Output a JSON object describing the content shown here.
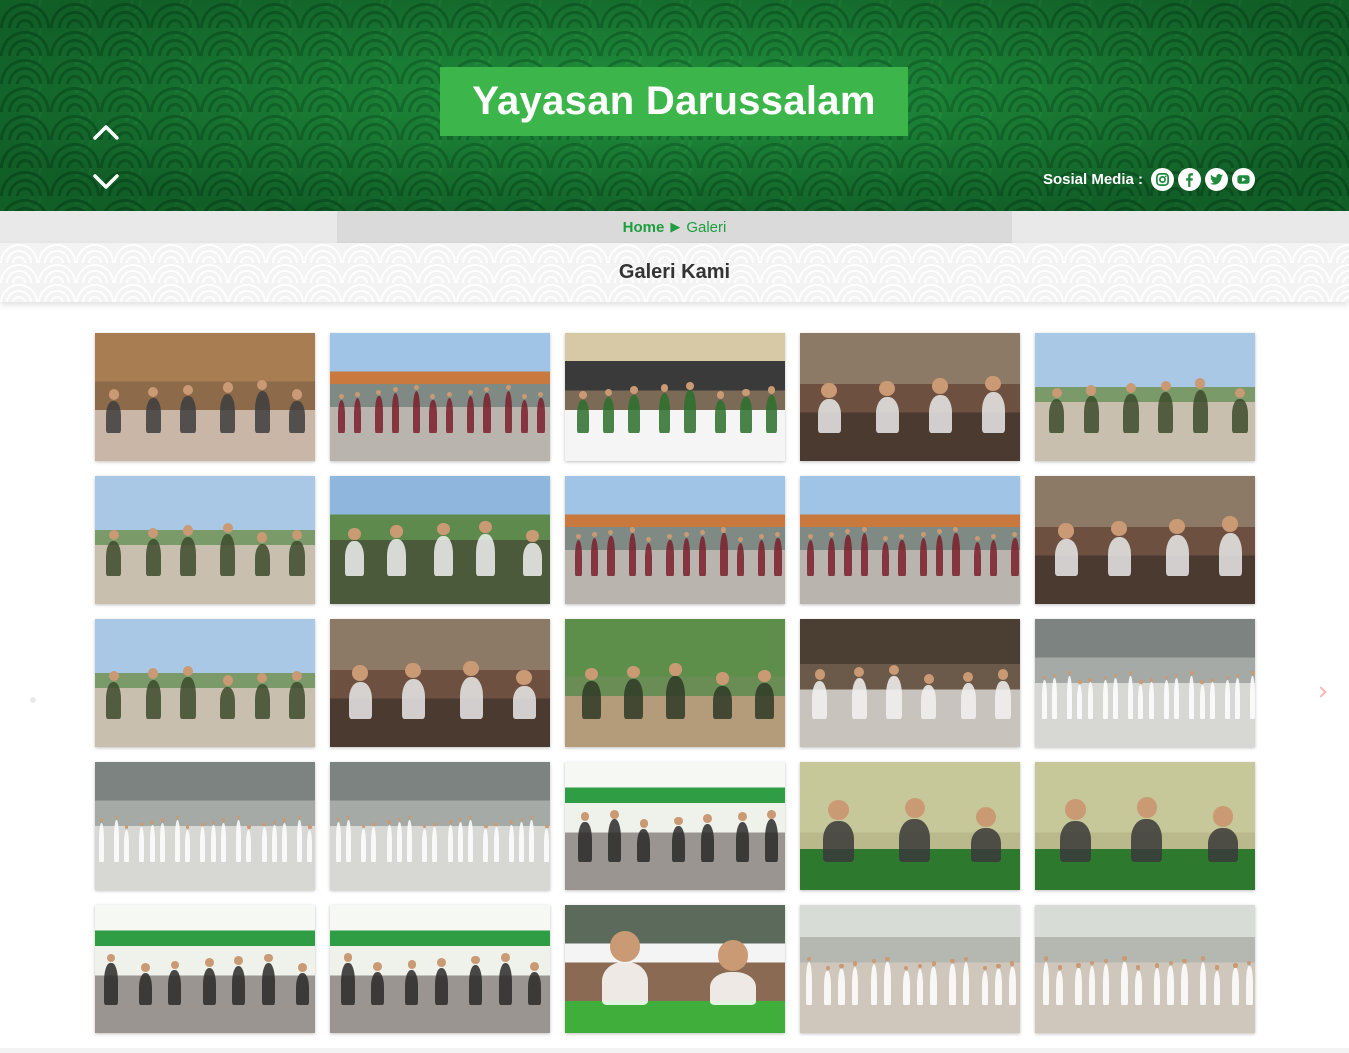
{
  "header": {
    "site_title": "Yayasan Darussalam",
    "social_label": "Sosial Media :",
    "social_links": [
      "instagram-icon",
      "facebook-icon",
      "twitter-icon",
      "youtube-icon"
    ],
    "colors": {
      "hero_green": "#1f8a3b",
      "title_box": "#3cb54a",
      "accent": "#1d9e3e"
    }
  },
  "breadcrumb": {
    "home": "Home",
    "separator": "▶",
    "current": "Galeri"
  },
  "section": {
    "title": "Galeri Kami"
  },
  "gallery": {
    "photos": [
      {
        "scene": "indoor-meeting"
      },
      {
        "scene": "outdoor-lineup"
      },
      {
        "scene": "crowd-front"
      },
      {
        "scene": "indoor-sofa"
      },
      {
        "scene": "outdoor-field"
      },
      {
        "scene": "outdoor-field"
      },
      {
        "scene": "outdoor-handover"
      },
      {
        "scene": "outdoor-lineup"
      },
      {
        "scene": "outdoor-lineup"
      },
      {
        "scene": "indoor-sofa"
      },
      {
        "scene": "outdoor-field"
      },
      {
        "scene": "indoor-sofa"
      },
      {
        "scene": "outdoor-group"
      },
      {
        "scene": "hall-group"
      },
      {
        "scene": "hall-exam"
      },
      {
        "scene": "hall-exam"
      },
      {
        "scene": "hall-exam"
      },
      {
        "scene": "banner-group"
      },
      {
        "scene": "empty-room"
      },
      {
        "scene": "empty-room"
      },
      {
        "scene": "banner-group"
      },
      {
        "scene": "banner-group"
      },
      {
        "scene": "portrait-closeup"
      },
      {
        "scene": "classroom"
      },
      {
        "scene": "classroom"
      }
    ]
  }
}
